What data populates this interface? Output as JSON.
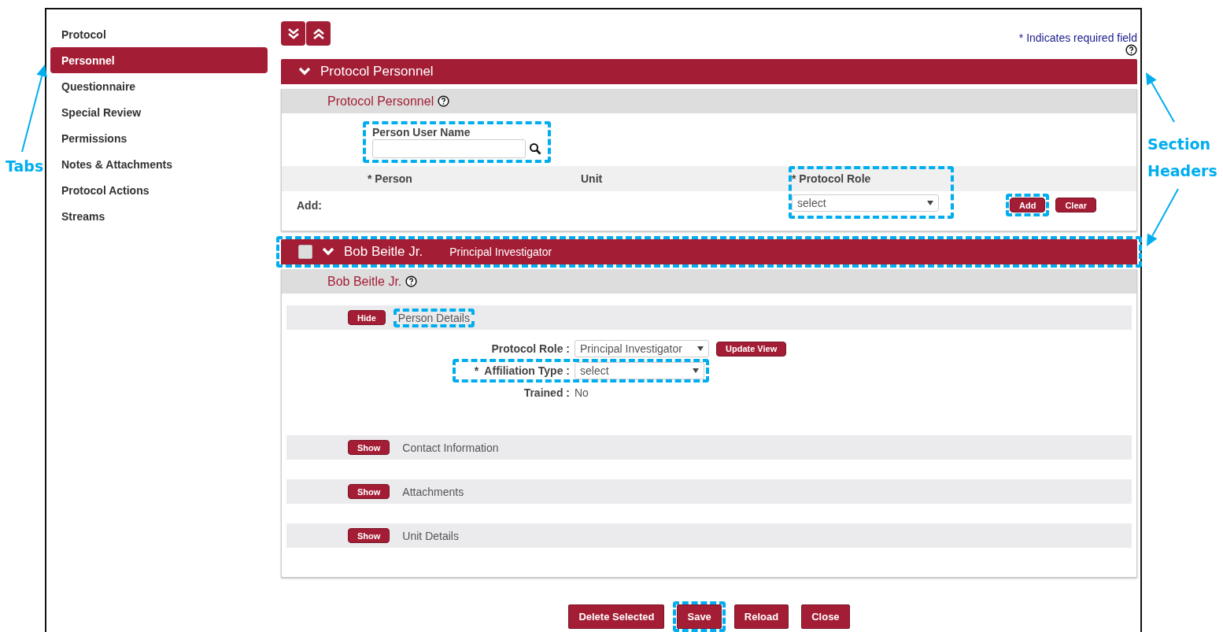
{
  "callouts": [
    {
      "label": "Tabs"
    },
    {
      "label": "Section Headers"
    }
  ],
  "sidebar": {
    "items": [
      {
        "label": "Protocol",
        "selected": false
      },
      {
        "label": "Personnel",
        "selected": true
      },
      {
        "label": "Questionnaire",
        "selected": false
      },
      {
        "label": "Special Review",
        "selected": false
      },
      {
        "label": "Permissions",
        "selected": false
      },
      {
        "label": "Notes & Attachments",
        "selected": false
      },
      {
        "label": "Protocol Actions",
        "selected": false
      },
      {
        "label": "Streams",
        "selected": false
      }
    ]
  },
  "toolbar": {
    "buttons": [
      {
        "kind": "expand-all"
      },
      {
        "kind": "collapse-all"
      }
    ]
  },
  "required_note": "* Indicates required field",
  "sections": [
    {
      "kind": "add-personnel",
      "title": "Protocol Personnel",
      "expanded": true,
      "highlighted": false,
      "subtitle": "Protocol Personnel",
      "lookup": {
        "label": "Person User Name",
        "highlighted": true
      },
      "columns": [
        {
          "label": "* Person"
        },
        {
          "label": "Unit"
        },
        {
          "label": "* Protocol Role"
        }
      ],
      "role_highlighted": true,
      "add_row": {
        "label": "Add:",
        "role_select": "select",
        "buttons": [
          {
            "label": "Add",
            "highlighted": true
          },
          {
            "label": "Clear",
            "highlighted": false
          }
        ]
      }
    },
    {
      "kind": "person",
      "title": "Bob Beitle Jr.",
      "role": "Principal Investigator",
      "checked": false,
      "expanded": true,
      "highlighted": true,
      "subtitle": "Bob Beitle Jr.",
      "subsections": [
        {
          "title": "Person Details",
          "toggle": "Hide",
          "highlighted": true,
          "fields": [
            {
              "kind": "select",
              "label": "Protocol Role :",
              "value": "Principal Investigator",
              "button": "Update View",
              "highlighted": false
            },
            {
              "kind": "select",
              "label": "*  Affiliation Type :",
              "value": "select",
              "highlighted": true
            },
            {
              "kind": "text",
              "label": "Trained :",
              "value": "No",
              "highlighted": false
            }
          ]
        },
        {
          "title": "Contact Information",
          "toggle": "Show",
          "highlighted": false
        },
        {
          "title": "Attachments",
          "toggle": "Show",
          "highlighted": false
        },
        {
          "title": "Unit Details",
          "toggle": "Show",
          "highlighted": false
        }
      ]
    }
  ],
  "footer": {
    "buttons": [
      {
        "label": "Delete Selected",
        "highlighted": false
      },
      {
        "label": "Save",
        "highlighted": true
      },
      {
        "label": "Reload",
        "highlighted": false
      },
      {
        "label": "Close",
        "highlighted": false
      }
    ]
  }
}
